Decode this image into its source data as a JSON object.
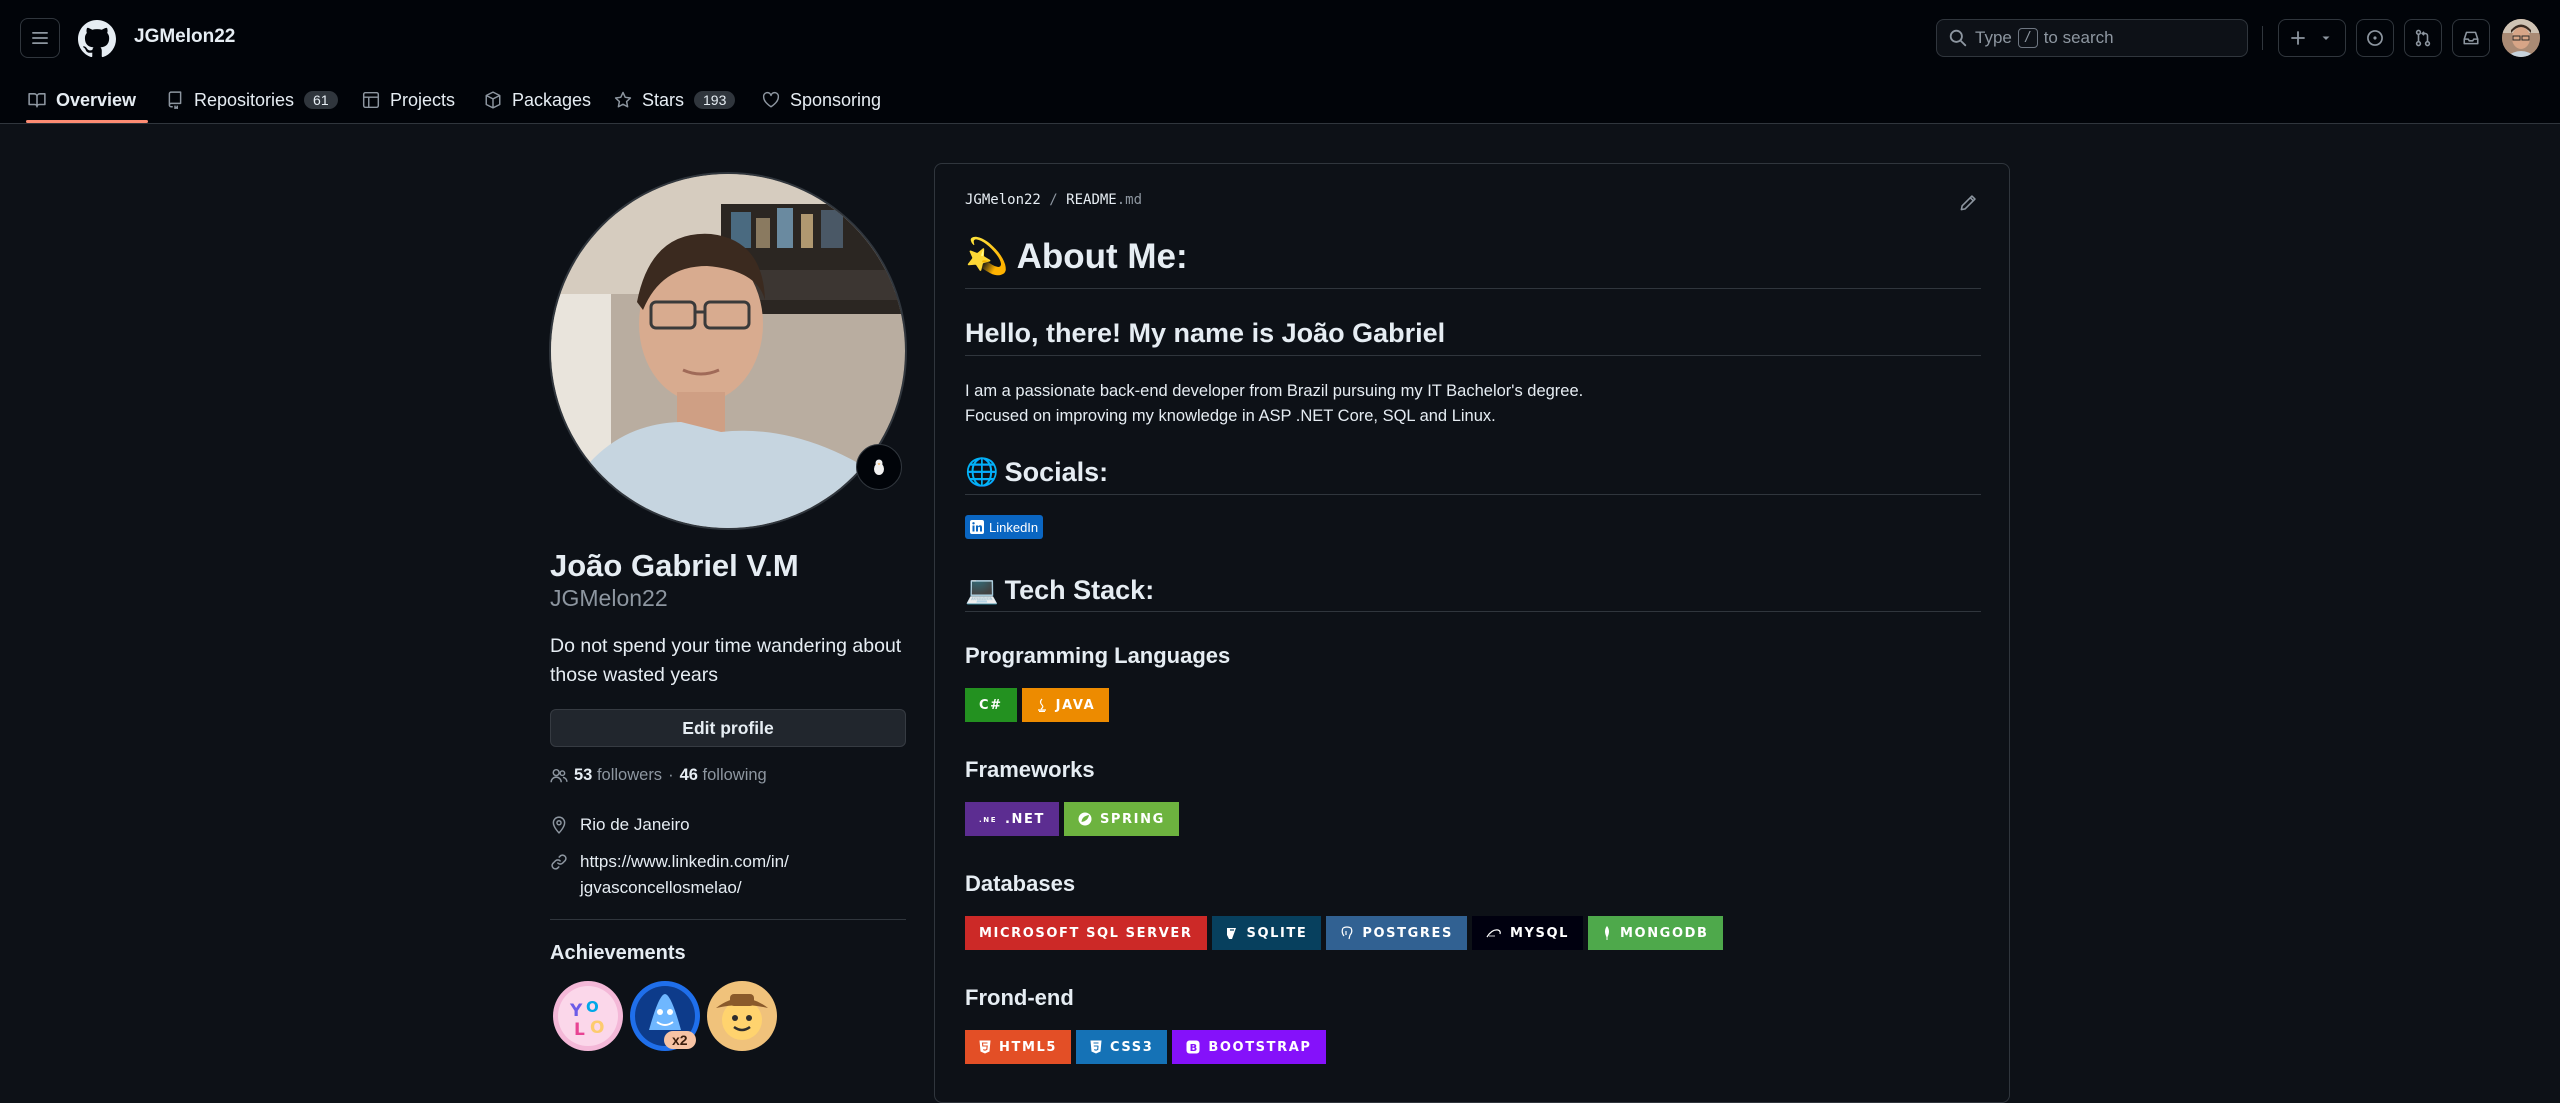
{
  "header": {
    "username": "JGMelon22",
    "search": {
      "before": "Type",
      "key": "/",
      "after": "to search"
    }
  },
  "tabs": [
    {
      "label": "Overview",
      "icon": "book-icon"
    },
    {
      "label": "Repositories",
      "count": "61",
      "icon": "repo-icon"
    },
    {
      "label": "Projects",
      "icon": "table-icon"
    },
    {
      "label": "Packages",
      "icon": "package-icon"
    },
    {
      "label": "Stars",
      "count": "193",
      "icon": "star-icon"
    },
    {
      "label": "Sponsoring",
      "icon": "heart-icon"
    }
  ],
  "profile": {
    "name": "João Gabriel V.M",
    "login": "JGMelon22",
    "bio": "Do not spend your time wandering about those wasted years",
    "edit_label": "Edit profile",
    "followers": "53",
    "followers_label": "followers",
    "following": "46",
    "following_label": "following",
    "location": "Rio de Janeiro",
    "link_line1": "https://www.linkedin.com/in/",
    "link_line2": "jgvasconcellosmelao/",
    "achievements_title": "Achievements",
    "achievement_multiplier": "x2"
  },
  "readme": {
    "owner": "JGMelon22",
    "file_base": "README",
    "file_ext": ".md",
    "about_emoji": "💫",
    "about_title": "About Me:",
    "hello": "Hello, there! My name is João Gabriel",
    "para1": "I am a passionate back-end developer from Brazil pursuing my IT Bachelor's degree.",
    "para2": "Focused on improving my knowledge in ASP .NET Core, SQL and Linux.",
    "socials_emoji": "🌐",
    "socials_title": "Socials:",
    "linkedin_label": "LinkedIn",
    "tech_emoji": "💻",
    "tech_title": "Tech Stack:",
    "sections": [
      {
        "title": "Programming Languages",
        "badges": [
          {
            "label": "C#",
            "color": "#239120"
          },
          {
            "label": "JAVA",
            "color": "#ed8b00"
          }
        ]
      },
      {
        "title": "Frameworks",
        "badges": [
          {
            "label": ".NET",
            "color": "#5c2d91"
          },
          {
            "label": "SPRING",
            "color": "#6db33f"
          }
        ]
      },
      {
        "title": "Databases",
        "badges": [
          {
            "label": "MICROSOFT SQL SERVER",
            "color": "#cc2927"
          },
          {
            "label": "SQLITE",
            "color": "#07405e"
          },
          {
            "label": "POSTGRES",
            "color": "#316192"
          },
          {
            "label": "MYSQL",
            "color": "#00000f"
          },
          {
            "label": "MONGODB",
            "color": "#4ea94b"
          }
        ]
      },
      {
        "title": "Frond-end",
        "badges": [
          {
            "label": "HTML5",
            "color": "#e34f26"
          },
          {
            "label": "CSS3",
            "color": "#1572b6"
          },
          {
            "label": "BOOTSTRAP",
            "color": "#8511fa"
          }
        ]
      }
    ]
  },
  "colors": {
    "background": "#0d1117",
    "header": "#010409",
    "border": "#30363d",
    "tab_underline": "#fd8c73",
    "muted": "#8d96a0"
  }
}
